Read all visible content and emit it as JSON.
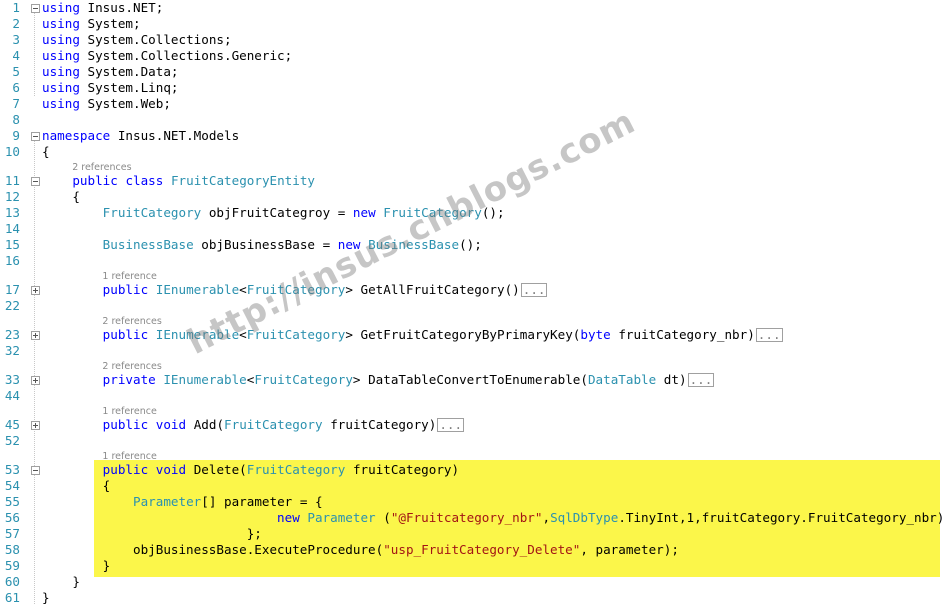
{
  "colors": {
    "keyword": "#0000ff",
    "type": "#2b91af",
    "string": "#a31515",
    "line_number": "#2b91af",
    "highlight": "#fbf64a",
    "reference_lens": "#8a8a8a"
  },
  "watermark": "http://insus.cnblogs.com",
  "lines": [
    {
      "num": "1",
      "fold": "minus",
      "tokens": [
        {
          "t": "using",
          "k": "kw"
        },
        {
          "t": " Insus.NET;",
          "k": "tx"
        }
      ]
    },
    {
      "num": "2",
      "tokens": [
        {
          "t": "using",
          "k": "kw"
        },
        {
          "t": " System;",
          "k": "tx"
        }
      ]
    },
    {
      "num": "3",
      "tokens": [
        {
          "t": "using",
          "k": "kw"
        },
        {
          "t": " System.Collections;",
          "k": "tx"
        }
      ]
    },
    {
      "num": "4",
      "tokens": [
        {
          "t": "using",
          "k": "kw"
        },
        {
          "t": " System.Collections.Generic;",
          "k": "tx"
        }
      ]
    },
    {
      "num": "5",
      "tokens": [
        {
          "t": "using",
          "k": "kw"
        },
        {
          "t": " System.Data;",
          "k": "tx"
        }
      ]
    },
    {
      "num": "6",
      "tokens": [
        {
          "t": "using",
          "k": "kw"
        },
        {
          "t": " System.Linq;",
          "k": "tx"
        }
      ]
    },
    {
      "num": "7",
      "tokens": [
        {
          "t": "using",
          "k": "kw"
        },
        {
          "t": " System.Web;",
          "k": "tx"
        }
      ]
    },
    {
      "num": "8",
      "tokens": []
    },
    {
      "num": "9",
      "fold": "minus",
      "tokens": [
        {
          "t": "namespace",
          "k": "kw"
        },
        {
          "t": " Insus.NET.Models",
          "k": "tx"
        }
      ]
    },
    {
      "num": "10",
      "tokens": [
        {
          "t": "{",
          "k": "tx"
        }
      ]
    },
    {
      "ref": "2 references",
      "indent": 4
    },
    {
      "num": "11",
      "fold": "minus",
      "tokens": [
        {
          "t": "    ",
          "k": "tx"
        },
        {
          "t": "public",
          "k": "kw"
        },
        {
          "t": " ",
          "k": "tx"
        },
        {
          "t": "class",
          "k": "kw"
        },
        {
          "t": " ",
          "k": "tx"
        },
        {
          "t": "FruitCategoryEntity",
          "k": "ty"
        }
      ]
    },
    {
      "num": "12",
      "tokens": [
        {
          "t": "    {",
          "k": "tx"
        }
      ]
    },
    {
      "num": "13",
      "tokens": [
        {
          "t": "        ",
          "k": "tx"
        },
        {
          "t": "FruitCategory",
          "k": "ty"
        },
        {
          "t": " objFruitCategroy = ",
          "k": "tx"
        },
        {
          "t": "new",
          "k": "kw"
        },
        {
          "t": " ",
          "k": "tx"
        },
        {
          "t": "FruitCategory",
          "k": "ty"
        },
        {
          "t": "();",
          "k": "tx"
        }
      ]
    },
    {
      "num": "14",
      "tokens": []
    },
    {
      "num": "15",
      "tokens": [
        {
          "t": "        ",
          "k": "tx"
        },
        {
          "t": "BusinessBase",
          "k": "ty"
        },
        {
          "t": " objBusinessBase = ",
          "k": "tx"
        },
        {
          "t": "new",
          "k": "kw"
        },
        {
          "t": " ",
          "k": "tx"
        },
        {
          "t": "BusinessBase",
          "k": "ty"
        },
        {
          "t": "();",
          "k": "tx"
        }
      ]
    },
    {
      "num": "16",
      "tokens": []
    },
    {
      "ref": "1 reference",
      "indent": 8
    },
    {
      "num": "17",
      "fold": "plus",
      "tokens": [
        {
          "t": "        ",
          "k": "tx"
        },
        {
          "t": "public",
          "k": "kw"
        },
        {
          "t": " ",
          "k": "tx"
        },
        {
          "t": "IEnumerable",
          "k": "ty"
        },
        {
          "t": "<",
          "k": "tx"
        },
        {
          "t": "FruitCategory",
          "k": "ty"
        },
        {
          "t": "> GetAllFruitCategory()",
          "k": "tx"
        }
      ],
      "collapsed": "..."
    },
    {
      "num": "22",
      "tokens": []
    },
    {
      "ref": "2 references",
      "indent": 8
    },
    {
      "num": "23",
      "fold": "plus",
      "tokens": [
        {
          "t": "        ",
          "k": "tx"
        },
        {
          "t": "public",
          "k": "kw"
        },
        {
          "t": " ",
          "k": "tx"
        },
        {
          "t": "IEnumerable",
          "k": "ty"
        },
        {
          "t": "<",
          "k": "tx"
        },
        {
          "t": "FruitCategory",
          "k": "ty"
        },
        {
          "t": "> GetFruitCategoryByPrimaryKey(",
          "k": "tx"
        },
        {
          "t": "byte",
          "k": "kw"
        },
        {
          "t": " fruitCategory_nbr)",
          "k": "tx"
        }
      ],
      "collapsed": "..."
    },
    {
      "num": "32",
      "tokens": []
    },
    {
      "ref": "2 references",
      "indent": 8
    },
    {
      "num": "33",
      "fold": "plus",
      "tokens": [
        {
          "t": "        ",
          "k": "tx"
        },
        {
          "t": "private",
          "k": "kw"
        },
        {
          "t": " ",
          "k": "tx"
        },
        {
          "t": "IEnumerable",
          "k": "ty"
        },
        {
          "t": "<",
          "k": "tx"
        },
        {
          "t": "FruitCategory",
          "k": "ty"
        },
        {
          "t": "> DataTableConvertToEnumerable(",
          "k": "tx"
        },
        {
          "t": "DataTable",
          "k": "ty"
        },
        {
          "t": " dt)",
          "k": "tx"
        }
      ],
      "collapsed": "..."
    },
    {
      "num": "44",
      "tokens": []
    },
    {
      "ref": "1 reference",
      "indent": 8
    },
    {
      "num": "45",
      "fold": "plus",
      "tokens": [
        {
          "t": "        ",
          "k": "tx"
        },
        {
          "t": "public",
          "k": "kw"
        },
        {
          "t": " ",
          "k": "tx"
        },
        {
          "t": "void",
          "k": "kw"
        },
        {
          "t": " Add(",
          "k": "tx"
        },
        {
          "t": "FruitCategory",
          "k": "ty"
        },
        {
          "t": " fruitCategory)",
          "k": "tx"
        }
      ],
      "collapsed": "..."
    },
    {
      "num": "52",
      "tokens": []
    },
    {
      "ref": "1 reference",
      "indent": 8
    },
    {
      "num": "53",
      "fold": "minus",
      "tokens": [
        {
          "t": "        ",
          "k": "tx"
        },
        {
          "t": "public",
          "k": "kw"
        },
        {
          "t": " ",
          "k": "tx"
        },
        {
          "t": "void",
          "k": "kw"
        },
        {
          "t": " Delete(",
          "k": "tx"
        },
        {
          "t": "FruitCategory",
          "k": "ty"
        },
        {
          "t": " fruitCategory)",
          "k": "tx"
        }
      ]
    },
    {
      "num": "54",
      "tokens": [
        {
          "t": "        {",
          "k": "tx"
        }
      ]
    },
    {
      "num": "55",
      "tokens": [
        {
          "t": "            ",
          "k": "tx"
        },
        {
          "t": "Parameter",
          "k": "ty"
        },
        {
          "t": "[] parameter = {",
          "k": "tx"
        }
      ]
    },
    {
      "num": "56",
      "tokens": [
        {
          "t": "                               ",
          "k": "tx"
        },
        {
          "t": "new",
          "k": "kw"
        },
        {
          "t": " ",
          "k": "tx"
        },
        {
          "t": "Parameter",
          "k": "ty"
        },
        {
          "t": " (",
          "k": "tx"
        },
        {
          "t": "\"@Fruitcategory_nbr\"",
          "k": "st"
        },
        {
          "t": ",",
          "k": "tx"
        },
        {
          "t": "SqlDbType",
          "k": "ty"
        },
        {
          "t": ".TinyInt,1,fruitCategory.FruitCategory_nbr)",
          "k": "tx"
        }
      ]
    },
    {
      "num": "57",
      "tokens": [
        {
          "t": "                           };",
          "k": "tx"
        }
      ]
    },
    {
      "num": "58",
      "tokens": [
        {
          "t": "            objBusinessBase.ExecuteProcedure(",
          "k": "tx"
        },
        {
          "t": "\"usp_FruitCategory_Delete\"",
          "k": "st"
        },
        {
          "t": ", parameter);",
          "k": "tx"
        }
      ]
    },
    {
      "num": "59",
      "tokens": [
        {
          "t": "        }",
          "k": "tx"
        }
      ]
    },
    {
      "num": "60",
      "tokens": [
        {
          "t": "    }",
          "k": "tx"
        }
      ]
    },
    {
      "num": "61",
      "tokens": [
        {
          "t": "}",
          "k": "tx"
        }
      ]
    }
  ]
}
